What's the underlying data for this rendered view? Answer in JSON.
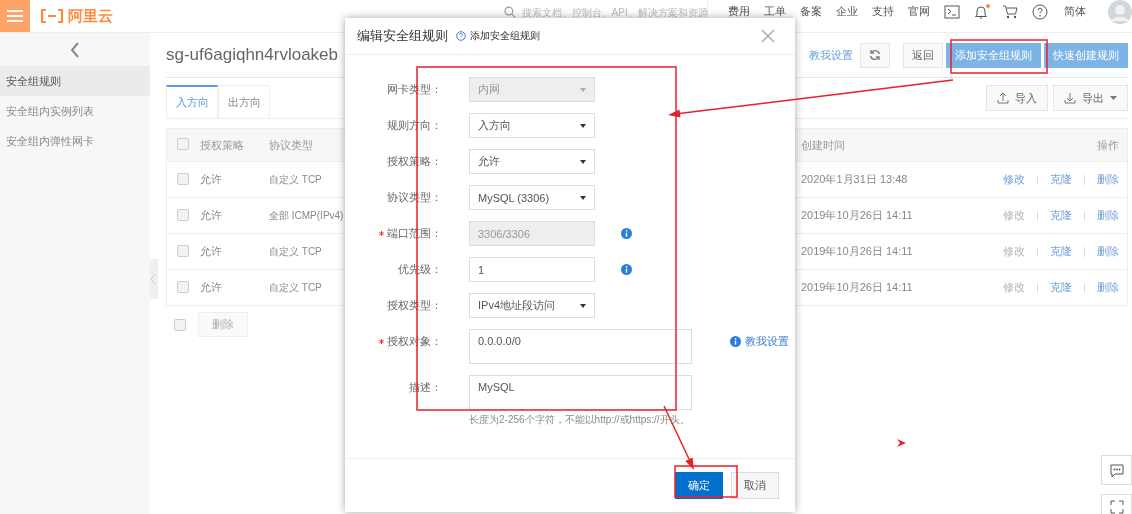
{
  "top_bar": {
    "logo": "阿里云",
    "search": {
      "placeholder": "搜索文档、控制台、API、解决方案和资源"
    },
    "nav": [
      "费用",
      "工单",
      "备案",
      "企业",
      "支持",
      "官网"
    ],
    "notifications": {
      "unread": true
    },
    "language": "简体"
  },
  "sidebar": {
    "items": [
      {
        "label": "安全组规则",
        "selected": true
      },
      {
        "label": "安全组内实例列表",
        "selected": false
      },
      {
        "label": "安全组内弹性网卡",
        "selected": false
      }
    ]
  },
  "page": {
    "title": "sg-uf6agiqhn4rvloakeb",
    "help_link": "教我设置",
    "buttons": [
      {
        "label": "返回",
        "kind": "default"
      },
      {
        "label": "添加安全组规则",
        "kind": "primary"
      },
      {
        "label": "快速创建规则",
        "kind": "primary"
      }
    ]
  },
  "tabs": [
    {
      "label": "入方向",
      "selected": true
    },
    {
      "label": "出方向",
      "selected": false
    }
  ],
  "tools": [
    {
      "label": "导入",
      "kind": "import"
    },
    {
      "label": "导出",
      "kind": "export"
    }
  ],
  "table": {
    "columns": [
      "授权策略",
      "协议类型",
      "创建时间",
      "操作"
    ],
    "all_checked": false,
    "rows": [
      {
        "checked": false,
        "policy": "允许",
        "protocol": "自定义 TCP",
        "created": "2020年1月31日 13:48",
        "actions": [
          {
            "label": "修改",
            "disabled": false
          },
          {
            "label": "克隆",
            "disabled": false
          },
          {
            "label": "删除",
            "disabled": false
          }
        ]
      },
      {
        "checked": false,
        "policy": "允许",
        "protocol": "全部 ICMP(IPv4)",
        "created": "2019年10月26日 14:11",
        "actions": [
          {
            "label": "修改",
            "disabled": true
          },
          {
            "label": "克隆",
            "disabled": false
          },
          {
            "label": "删除",
            "disabled": false
          }
        ]
      },
      {
        "checked": false,
        "policy": "允许",
        "protocol": "自定义 TCP",
        "created": "2019年10月26日 14:11",
        "actions": [
          {
            "label": "修改",
            "disabled": true
          },
          {
            "label": "克隆",
            "disabled": false
          },
          {
            "label": "删除",
            "disabled": false
          }
        ]
      },
      {
        "checked": false,
        "policy": "允许",
        "protocol": "自定义 TCP",
        "created": "2019年10月26日 14:11",
        "actions": [
          {
            "label": "修改",
            "disabled": true
          },
          {
            "label": "克隆",
            "disabled": false
          },
          {
            "label": "删除",
            "disabled": false
          }
        ]
      }
    ],
    "footer_checked": false,
    "footer_button": {
      "label": "删除",
      "disabled": true
    }
  },
  "dialog": {
    "title": "编辑安全组规则",
    "help_link": "添加安全组规则",
    "fields": [
      {
        "label": "网卡类型：",
        "kind": "select",
        "value": "内网",
        "disabled": true,
        "required": false,
        "info": false
      },
      {
        "label": "规则方向：",
        "kind": "select",
        "value": "入方向",
        "disabled": false,
        "required": false,
        "info": false
      },
      {
        "label": "授权策略：",
        "kind": "select",
        "value": "允许",
        "disabled": false,
        "required": false,
        "info": false
      },
      {
        "label": "协议类型：",
        "kind": "select",
        "value": "MySQL (3306)",
        "disabled": false,
        "required": false,
        "info": false
      },
      {
        "label": "端口范围：",
        "kind": "input",
        "value": "3306/3306",
        "disabled": true,
        "required": true,
        "info": true
      },
      {
        "label": "优先级：",
        "kind": "input",
        "value": "1",
        "disabled": false,
        "required": false,
        "info": true
      },
      {
        "label": "授权类型：",
        "kind": "select",
        "value": "IPv4地址段访问",
        "disabled": false,
        "required": false,
        "info": false
      },
      {
        "label": "授权对象：",
        "kind": "textarea",
        "value": "0.0.0.0/0",
        "disabled": false,
        "required": true,
        "info": false,
        "link": "教我设置"
      },
      {
        "label": "描述：",
        "kind": "textarea",
        "value": "MySQL",
        "disabled": false,
        "required": false,
        "info": false
      }
    ],
    "hint": "长度为2-256个字符，不能以http://或https://开头。",
    "buttons": [
      {
        "label": "确定",
        "kind": "primary"
      },
      {
        "label": "取消",
        "kind": "default"
      }
    ]
  }
}
